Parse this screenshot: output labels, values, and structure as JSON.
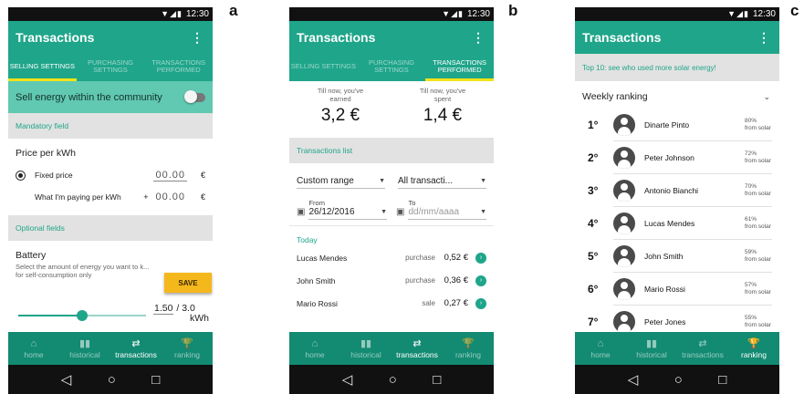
{
  "panel_letters": [
    "a",
    "b",
    "c"
  ],
  "status": {
    "time": "12:30",
    "icons": "▼◢▮"
  },
  "app_title": "Transactions",
  "menu_glyph": "⋮",
  "tabs": [
    "SELLING SETTINGS",
    "PURCHASING SETTINGS",
    "TRANSACTIONS PERFORMED"
  ],
  "nav": [
    {
      "label": "home",
      "icon": "home-icon",
      "glyph": "⌂"
    },
    {
      "label": "historical",
      "icon": "bar-chart-icon",
      "glyph": "▮▮"
    },
    {
      "label": "transactions",
      "icon": "swap-arrows-icon",
      "glyph": "⇄"
    },
    {
      "label": "ranking",
      "icon": "trophy-icon",
      "glyph": "🏆"
    }
  ],
  "sysnav": {
    "back": "◁",
    "home": "○",
    "recent": "□"
  },
  "colors": {
    "primary": "#1fa58a",
    "primary_dark": "#138a72",
    "accent": "#f5b81c",
    "indicator": "#f2e21a"
  },
  "panel_a": {
    "sell_label": "Sell energy within the community",
    "sell_enabled": false,
    "mandatory_header": "Mandatory field",
    "price_title": "Price per kWh",
    "fixed_price_label": "Fixed price",
    "fixed_price_value": "00.00",
    "currency": "€",
    "paying_label": "What I'm paying per kWh",
    "paying_sign": "+",
    "paying_value": "00.00",
    "optional_header": "Optional fields",
    "battery_title": "Battery",
    "battery_hint": "Select the amount of energy you want to k... for self-consumption only",
    "battery_value": "1.50",
    "battery_max": "/ 3.0",
    "battery_unit": "kWh",
    "battery_fraction": 0.5,
    "save_label": "SAVE"
  },
  "panel_b": {
    "earned_label": "Till now, you've earned",
    "earned_value": "3,2 €",
    "spent_label": "Till now, you've spent",
    "spent_value": "1,4 €",
    "list_header": "Transactions list",
    "range_filter": "Custom range",
    "type_filter": "All transacti...",
    "from_label": "From",
    "from_value": "26/12/2016",
    "to_label": "To",
    "to_placeholder": "dd/mm/aaaa",
    "today_label": "Today",
    "rows": [
      {
        "name": "Lucas Mendes",
        "type": "purchase",
        "amount": "0,52 €"
      },
      {
        "name": "John Smith",
        "type": "purchase",
        "amount": "0,36 €"
      },
      {
        "name": "Mario Rossi",
        "type": "sale",
        "amount": "0,27 €"
      }
    ]
  },
  "panel_c": {
    "banner": "Top 10: see who used more solar energy!",
    "weekly_label": "Weekly ranking",
    "rows": [
      {
        "pos": "1°",
        "name": "Dinarte Pinto",
        "pct": "80%",
        "suffix": "from solar"
      },
      {
        "pos": "2°",
        "name": "Peter Johnson",
        "pct": "72%",
        "suffix": "from solar"
      },
      {
        "pos": "3°",
        "name": "Antonio Bianchi",
        "pct": "70%",
        "suffix": "from solar"
      },
      {
        "pos": "4°",
        "name": "Lucas Mendes",
        "pct": "61%",
        "suffix": "from solar"
      },
      {
        "pos": "5°",
        "name": "John Smith",
        "pct": "59%",
        "suffix": "from solar"
      },
      {
        "pos": "6°",
        "name": "Mario Rossi",
        "pct": "57%",
        "suffix": "from solar"
      },
      {
        "pos": "7°",
        "name": "Peter Jones",
        "pct": "55%",
        "suffix": "from solar"
      }
    ]
  }
}
